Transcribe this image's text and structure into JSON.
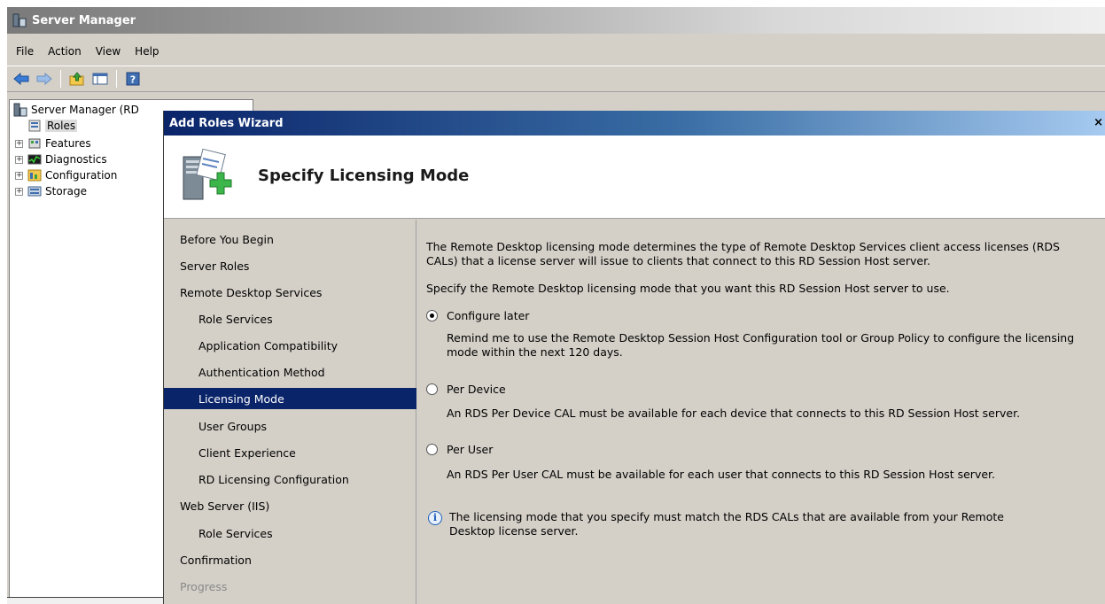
{
  "window": {
    "title": "Server Manager"
  },
  "menu": [
    "File",
    "Action",
    "View",
    "Help"
  ],
  "toolbar": {
    "icons": [
      "back-icon",
      "forward-icon",
      "up-icon",
      "show-hide-icon",
      "help-icon"
    ]
  },
  "tree": {
    "root": "Server Manager (RD",
    "items": [
      {
        "label": "Roles",
        "selected": true
      },
      {
        "label": "Features"
      },
      {
        "label": "Diagnostics"
      },
      {
        "label": "Configuration"
      },
      {
        "label": "Storage"
      }
    ]
  },
  "wizard": {
    "title": "Add Roles Wizard",
    "close": "×",
    "heading": "Specify Licensing Mode",
    "nav": [
      {
        "label": "Before You Begin",
        "level": 0
      },
      {
        "label": "Server Roles",
        "level": 0
      },
      {
        "label": "Remote Desktop Services",
        "level": 0
      },
      {
        "label": "Role Services",
        "level": 1
      },
      {
        "label": "Application Compatibility",
        "level": 1
      },
      {
        "label": "Authentication Method",
        "level": 1
      },
      {
        "label": "Licensing Mode",
        "level": 1,
        "active": true
      },
      {
        "label": "User Groups",
        "level": 1
      },
      {
        "label": "Client Experience",
        "level": 1
      },
      {
        "label": "RD Licensing Configuration",
        "level": 1
      },
      {
        "label": "Web Server (IIS)",
        "level": 0
      },
      {
        "label": "Role Services",
        "level": 1
      },
      {
        "label": "Confirmation",
        "level": 0
      },
      {
        "label": "Progress",
        "level": 0,
        "disabled": true
      }
    ],
    "intro": "The Remote Desktop licensing mode determines the type of Remote Desktop Services client access licenses (RDS CALs) that a license server will issue to clients that connect to this RD Session Host server.",
    "prompt": "Specify the Remote Desktop licensing mode that you want this RD Session Host server to use.",
    "options": [
      {
        "label": "Configure later",
        "checked": true,
        "description": "Remind me to use the Remote Desktop Session Host Configuration tool or Group Policy to configure the licensing mode within the next 120 days."
      },
      {
        "label": "Per Device",
        "checked": false,
        "description": "An RDS Per Device CAL must be available for each device that connects to this RD Session Host server."
      },
      {
        "label": "Per User",
        "checked": false,
        "description": "An RDS Per User CAL must be available for each user that connects to this RD Session Host server."
      }
    ],
    "note": "The licensing mode that you specify must match the RDS CALs that are available from your Remote Desktop license server."
  },
  "colors": {
    "wizard_title_start": "#0a246a",
    "nav_active_bg": "#0a246a",
    "dialog_bg": "#d4d0c8"
  }
}
